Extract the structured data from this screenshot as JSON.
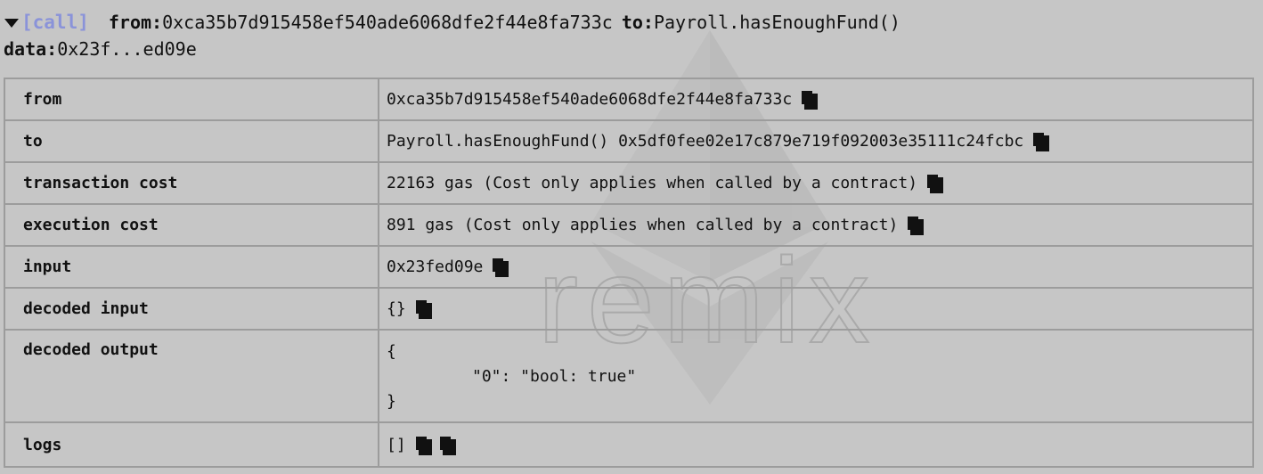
{
  "header": {
    "call_tag": "[call]",
    "from_key": "from:",
    "from_value": "0xca35b7d915458ef540ade6068dfe2f44e8fa733c",
    "to_key": "to:",
    "to_value": "Payroll.hasEnoughFund()",
    "data_key": "data:",
    "data_value": "0x23f...ed09e"
  },
  "watermark": {
    "text": "remix"
  },
  "rows": [
    {
      "label": "from",
      "value": "0xca35b7d915458ef540ade6068dfe2f44e8fa733c"
    },
    {
      "label": "to",
      "value": "Payroll.hasEnoughFund() 0x5df0fee02e17c879e719f092003e35111c24fcbc"
    },
    {
      "label": "transaction cost",
      "value": "22163 gas (Cost only applies when called by a contract)"
    },
    {
      "label": "execution cost",
      "value": "891 gas (Cost only applies when called by a contract)"
    },
    {
      "label": "input",
      "value": "0x23fed09e"
    },
    {
      "label": "decoded input",
      "value": "{}"
    },
    {
      "label": "decoded output",
      "lines": [
        "{",
        "\"0\": \"bool: true\"",
        "}"
      ]
    },
    {
      "label": "logs",
      "value": "[]"
    }
  ],
  "colors": {
    "background": "#c6c6c6",
    "call_tag": "#8a93d9",
    "border": "#9c9c9c"
  }
}
